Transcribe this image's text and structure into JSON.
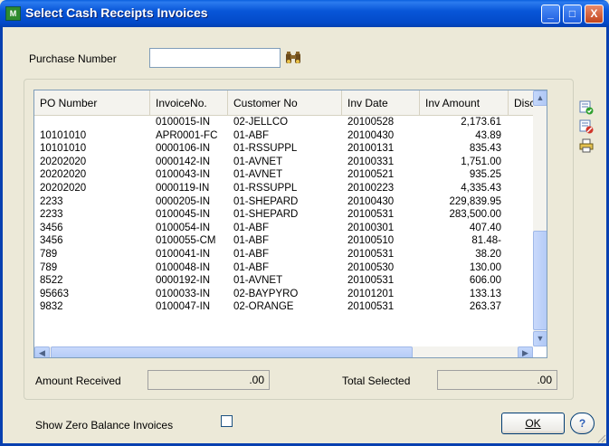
{
  "window": {
    "title": "Select Cash Receipts Invoices",
    "icon": "app-icon",
    "controls": {
      "minimize": "_",
      "maximize": "□",
      "close": "X"
    }
  },
  "purchase": {
    "label": "Purchase Number",
    "value": "",
    "search_icon": "binoculars-icon"
  },
  "grid": {
    "columns": [
      "PO Number",
      "InvoiceNo.",
      "Customer No",
      "Inv Date",
      "Inv Amount",
      "Disc A"
    ],
    "rows": [
      [
        "",
        "0100015-IN",
        "02-JELLCO",
        "20100528",
        "2,173.61"
      ],
      [
        "10101010",
        "APR0001-FC",
        "01-ABF",
        "20100430",
        "43.89"
      ],
      [
        "10101010",
        "0000106-IN",
        "01-RSSUPPL",
        "20100131",
        "835.43"
      ],
      [
        "20202020",
        "0000142-IN",
        "01-AVNET",
        "20100331",
        "1,751.00"
      ],
      [
        "20202020",
        "0100043-IN",
        "01-AVNET",
        "20100521",
        "935.25"
      ],
      [
        "20202020",
        "0000119-IN",
        "01-RSSUPPL",
        "20100223",
        "4,335.43"
      ],
      [
        "2233",
        "0000205-IN",
        "01-SHEPARD",
        "20100430",
        "229,839.95"
      ],
      [
        "2233",
        "0100045-IN",
        "01-SHEPARD",
        "20100531",
        "283,500.00"
      ],
      [
        "3456",
        "0100054-IN",
        "01-ABF",
        "20100301",
        "407.40"
      ],
      [
        "3456",
        "0100055-CM",
        "01-ABF",
        "20100510",
        "81.48-"
      ],
      [
        "789",
        "0100041-IN",
        "01-ABF",
        "20100531",
        "38.20"
      ],
      [
        "789",
        "0100048-IN",
        "01-ABF",
        "20100530",
        "130.00"
      ],
      [
        "8522",
        "0000192-IN",
        "01-AVNET",
        "20100531",
        "606.00"
      ],
      [
        "95663",
        "0100033-IN",
        "02-BAYPYRO",
        "20101201",
        "133.13"
      ],
      [
        "9832",
        "0100047-IN",
        "02-ORANGE",
        "20100531",
        "263.37"
      ]
    ]
  },
  "side_icons": [
    "select-all-icon",
    "clear-selection-icon",
    "print-icon"
  ],
  "totals": {
    "amount_received_label": "Amount Received",
    "amount_received_value": ".00",
    "total_selected_label": "Total Selected",
    "total_selected_value": ".00"
  },
  "options": {
    "show_zero_balance_label": "Show Zero Balance Invoices",
    "show_zero_balance_checked": false
  },
  "buttons": {
    "ok_label": "OK",
    "help_label": "?"
  },
  "colors": {
    "titlebar": "#0A5FDE",
    "window_bg": "#ECE9D8",
    "grid_bg": "#FFFFFF"
  }
}
